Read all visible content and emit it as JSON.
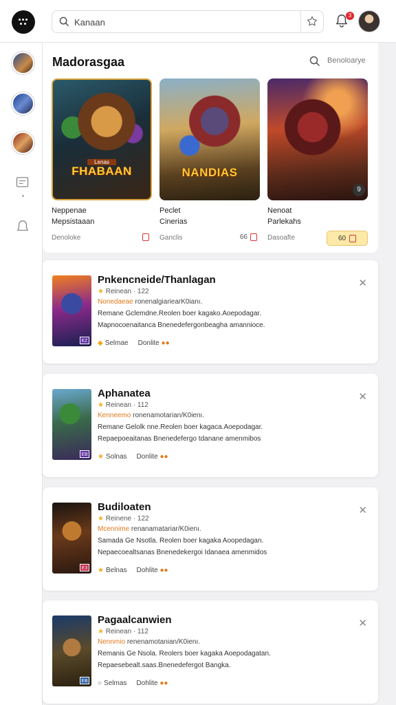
{
  "search": {
    "value": "Kanaan"
  },
  "header": {
    "notification_count": "3"
  },
  "featured": {
    "title": "Madorasgaa",
    "link_label": "Benoloarye",
    "cards": [
      {
        "name1": "Neppenae",
        "name2": "Mepsistaaan",
        "category": "Denoloke",
        "meta": "",
        "art_label": "FHABAAN",
        "art_sub": "Lenas"
      },
      {
        "name1": "Peclet",
        "name2": "Cinerias",
        "category": "Ganclis",
        "meta": "66",
        "art_label": "NANDIAS",
        "art_sub": ""
      },
      {
        "name1": "Nenoat",
        "name2": "Parlekahs",
        "category": "Dasoafte",
        "meta": "60",
        "art_label": "",
        "art_sub": ""
      }
    ]
  },
  "list": [
    {
      "title": "Pnkencneide/Thanlagan",
      "rating": "Reinean · 122",
      "line1_hl": "Nonedaeae",
      "line1": "ronenalgiariearK0ianı.",
      "line2": "Remane Gclemdne.Reolen boer kagako.Aoepodagar.",
      "line3": "Mapnocoenaitanca Bnenedefergonbeagha amannioce.",
      "tag1": "Selmae",
      "tag2": "Donlite",
      "badge": "EZ"
    },
    {
      "title": "Aphanatea",
      "rating": "Reinean · 112",
      "line1_hl": "Kenneemo",
      "line1": "ronenamotarian/K0ienı.",
      "line2": "Remane Gelolk nne.Reolen boer kagaca.Aoepodagar.",
      "line3": "Repaepoeaitanas Bnenedefergo tdanane amenmibos",
      "tag1": "Solnas",
      "tag2": "Donlite",
      "badge": "EB"
    },
    {
      "title": "Budiloaten",
      "rating": "Reinene · 122",
      "line1_hl": "Mcennime",
      "line1": "renanamatariar/K0ienı.",
      "line2": "Samada Ge Nsotla. Reolen boer kagaka Aoopedagan.",
      "line3": "Nepaecoealtsanas Bnenedekergoi Idanaea amenmidos",
      "tag1": "Belnas",
      "tag2": "Dohlite",
      "badge": "E3"
    },
    {
      "title": "Pagaalcanwien",
      "rating": "Reinean · 112",
      "line1_hl": "Nennmio",
      "line1": "renenamotanian/K0ienı.",
      "line2": "Remanis Ge Nsola. Reolers boer kagaka Aoepodagatan.",
      "line3": "Repaesebealt.saas.Bnenedefergot Bangka.",
      "tag1": "Selmas",
      "tag2": "Dohlite",
      "badge": "EB"
    }
  ]
}
